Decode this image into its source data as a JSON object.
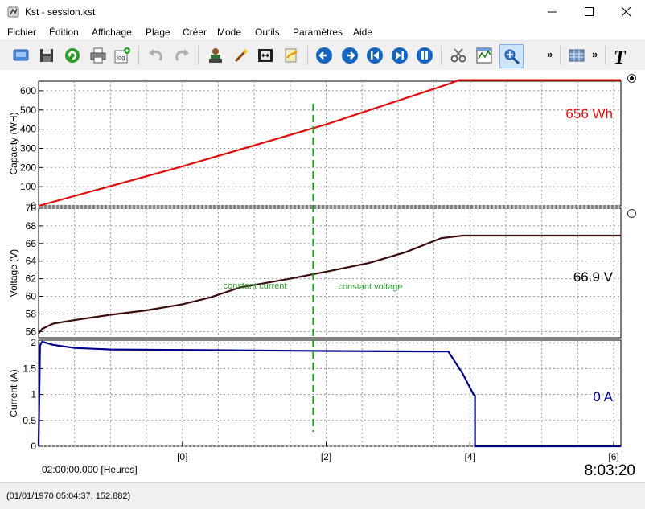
{
  "window": {
    "title": "Kst - session.kst"
  },
  "menu": [
    "Fichier",
    "Édition",
    "Affichage",
    "Plage",
    "Créer",
    "Mode",
    "Outils",
    "Paramètres",
    "Aide"
  ],
  "toolbar": {
    "overflow_label": "»"
  },
  "status": {
    "text": "(01/01/1970 05:04:37, 152.882)"
  },
  "plot": {
    "time_label": "02:00:00.000 [Heures]",
    "clock": "8:03:20",
    "x_ticks": [
      "[0]",
      "[2]",
      "[4]",
      "[6]"
    ],
    "annotations": {
      "left": "constant current",
      "right": "constant voltage"
    },
    "colors": {
      "capacity": "#e01010",
      "voltage": "#3a0e0e",
      "current": "#00008b",
      "marker": "#1a9b1a",
      "annotation": "#2a9a2a"
    }
  },
  "chart_data": [
    {
      "type": "line",
      "ylabel": "Capacity (WH)",
      "ylim": [
        0,
        650
      ],
      "xlim": [
        -2,
        6.1
      ],
      "y_ticks": [
        "0",
        "100",
        "200",
        "300",
        "400",
        "500",
        "600"
      ],
      "series": [
        {
          "x": [
            -2.0,
            0.0,
            2.0,
            3.7,
            3.85,
            6.1
          ],
          "y": [
            0,
            206,
            425,
            635,
            656,
            656
          ]
        }
      ],
      "readout": "656 Wh"
    },
    {
      "type": "line",
      "ylabel": "Voltage (V)",
      "ylim": [
        55.3,
        70
      ],
      "xlim": [
        -2,
        6.1
      ],
      "y_ticks": [
        "56",
        "58",
        "60",
        "62",
        "64",
        "66",
        "68",
        "70"
      ],
      "series": [
        {
          "x": [
            -2.0,
            -1.95,
            -1.8,
            -1.5,
            -1.0,
            -0.5,
            0.0,
            0.4,
            0.8,
            1.5,
            2.0,
            2.6,
            3.1,
            3.6,
            3.9,
            6.1
          ],
          "y": [
            55.8,
            56.3,
            56.9,
            57.3,
            57.9,
            58.4,
            59.1,
            59.9,
            61.0,
            62.0,
            62.8,
            63.8,
            65.0,
            66.6,
            66.9,
            66.9
          ]
        }
      ],
      "readout": "66.9 V"
    },
    {
      "type": "line",
      "ylabel": "Current (A)",
      "ylim": [
        0,
        2.05
      ],
      "xlim": [
        -2,
        6.1
      ],
      "y_ticks": [
        "0",
        "0.5",
        "1",
        "1.5",
        "2"
      ],
      "series": [
        {
          "x": [
            -2.0,
            -1.98,
            -1.95,
            -1.8,
            -1.5,
            -1.0,
            0.0,
            2.0,
            3.7,
            3.9,
            4.05,
            4.07,
            4.07,
            6.1
          ],
          "y": [
            0.0,
            1.95,
            2.02,
            1.96,
            1.9,
            1.87,
            1.86,
            1.84,
            1.83,
            1.4,
            1.0,
            0.98,
            0.0,
            0.0
          ]
        }
      ],
      "readout": "0 A"
    }
  ]
}
